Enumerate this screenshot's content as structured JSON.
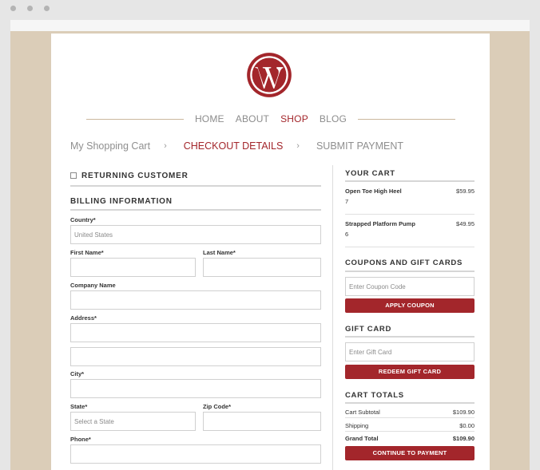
{
  "nav": {
    "items": [
      "HOME",
      "ABOUT",
      "SHOP",
      "BLOG"
    ],
    "active": "SHOP"
  },
  "breadcrumb": {
    "step1": "My Shopping Cart",
    "step2": "CHECKOUT DETAILS",
    "step3": "SUBMIT PAYMENT",
    "separator": "›"
  },
  "returning": {
    "label": "RETURNING CUSTOMER"
  },
  "billing": {
    "title": "BILLING INFORMATION",
    "country_label": "Country*",
    "country_value": "United States",
    "first_name_label": "First Name*",
    "last_name_label": "Last Name*",
    "company_label": "Company Name",
    "address_label": "Address*",
    "city_label": "City*",
    "state_label": "State*",
    "state_placeholder": "Select a State",
    "zip_label": "Zip Code*",
    "phone_label": "Phone*"
  },
  "cart": {
    "title": "YOUR CART",
    "items": [
      {
        "name": "Open Toe High Heel",
        "qty": "7",
        "price": "$59.95"
      },
      {
        "name": "Strapped Platform Pump",
        "qty": "6",
        "price": "$49.95"
      }
    ]
  },
  "coupons": {
    "title": "COUPONS AND GIFT CARDS",
    "placeholder": "Enter Coupon Code",
    "button": "APPLY COUPON"
  },
  "gift_card": {
    "title": "GIFT CARD",
    "placeholder": "Enter Gift Card",
    "button": "REDEEM GIFT CARD"
  },
  "totals": {
    "title": "CART TOTALS",
    "subtotal_label": "Cart Subtotal",
    "subtotal_value": "$109.90",
    "shipping_label": "Shipping",
    "shipping_value": "$0.00",
    "grand_label": "Grand Total",
    "grand_value": "$109.90",
    "button": "CONTINUE TO PAYMENT"
  },
  "colors": {
    "accent": "#a3262b",
    "background": "#dbcdb8"
  },
  "icons": {
    "logo": "wordpress-logo-icon"
  }
}
